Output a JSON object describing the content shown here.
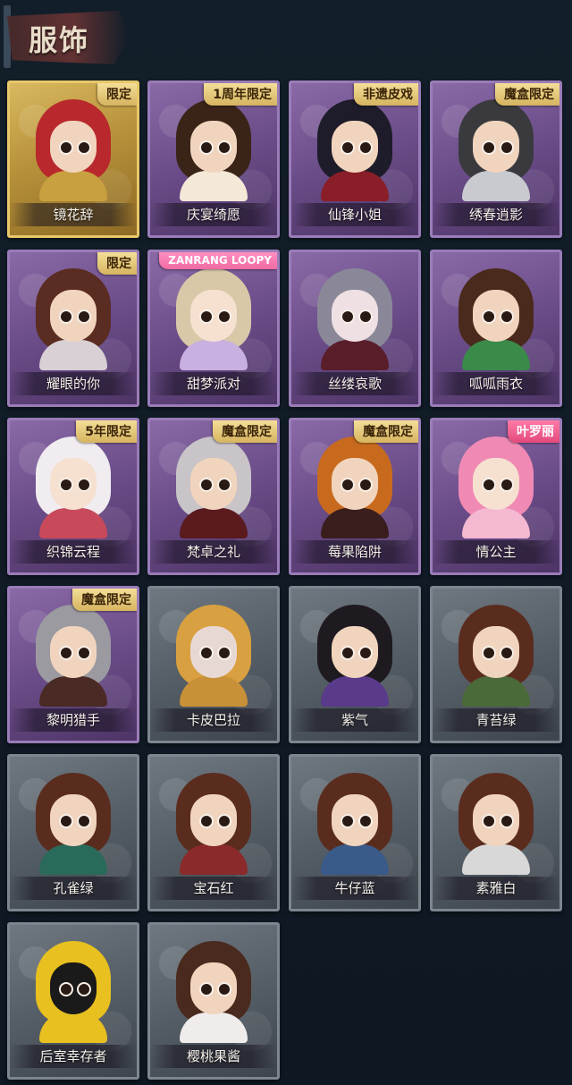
{
  "section_title": "服饰",
  "colors": {
    "background": "#0f1a24",
    "gold_card": "#d8b860",
    "purple_card": "#7a5c98",
    "gray_card": "#5a636b",
    "badge_gold": "#e6c878",
    "badge_pink": "#f06aa4"
  },
  "costumes": [
    {
      "name": "镜花辞",
      "badge": "限定",
      "frame": "gold",
      "hair": "#b8282c",
      "outfit": "#c8a040",
      "skin": "#f1d4bd"
    },
    {
      "name": "庆宴绮愿",
      "badge": "1周年限定",
      "frame": "purple",
      "hair": "#3a2418",
      "outfit": "#f4e8d8",
      "skin": "#f1d4bd"
    },
    {
      "name": "仙锋小姐",
      "badge": "非遗皮戏",
      "frame": "purple",
      "hair": "#1e1c2a",
      "outfit": "#8a1e28",
      "skin": "#f1d4bd"
    },
    {
      "name": "绣春逍影",
      "badge": "魔盒限定",
      "frame": "purple",
      "hair": "#3a3a3e",
      "outfit": "#c8cad0",
      "skin": "#f1d4bd"
    },
    {
      "name": "耀眼的你",
      "badge": "限定",
      "frame": "purple",
      "hair": "#5a2c22",
      "outfit": "#d8d0d4",
      "skin": "#f1d4bd"
    },
    {
      "name": "甜梦派对",
      "badge": "ZANRANG LOOPY",
      "frame": "purple",
      "hair": "#d8c8a8",
      "outfit": "#c8b0e0",
      "skin": "#f6e0d0"
    },
    {
      "name": "丝缕哀歌",
      "badge": "",
      "frame": "purple",
      "hair": "#8a8898",
      "outfit": "#5a1e2a",
      "skin": "#efe0e4"
    },
    {
      "name": "呱呱雨衣",
      "badge": "",
      "frame": "purple",
      "hair": "#4a2a1c",
      "outfit": "#3a8a4a",
      "skin": "#f1d4bd"
    },
    {
      "name": "织锦云程",
      "badge": "5年限定",
      "frame": "purple",
      "hair": "#f0ecf0",
      "outfit": "#c84a5a",
      "skin": "#f6e0d0"
    },
    {
      "name": "梵卓之礼",
      "badge": "魔盒限定",
      "frame": "purple",
      "hair": "#c8c4c8",
      "outfit": "#5a1a1e",
      "skin": "#f1d4bd"
    },
    {
      "name": "莓果陷阱",
      "badge": "魔盒限定",
      "frame": "purple",
      "hair": "#c86a1e",
      "outfit": "#3a1e1e",
      "skin": "#f1d4bd"
    },
    {
      "name": "情公主",
      "badge": "叶罗丽",
      "frame": "purple",
      "hair": "#f08ab4",
      "outfit": "#f4b8d0",
      "skin": "#f6e0d0"
    },
    {
      "name": "黎明猎手",
      "badge": "魔盒限定",
      "frame": "purple",
      "hair": "#9a9aa0",
      "outfit": "#4a2a24",
      "skin": "#f1d4bd"
    },
    {
      "name": "卡皮巴拉",
      "badge": "",
      "frame": "gray",
      "hair": "#d8a040",
      "outfit": "#c89038",
      "skin": "#e8d8d4"
    },
    {
      "name": "紫气",
      "badge": "",
      "frame": "gray",
      "hair": "#1e1a20",
      "outfit": "#5a3a8a",
      "skin": "#f1d4bd"
    },
    {
      "name": "青苔绿",
      "badge": "",
      "frame": "gray",
      "hair": "#5a2c1e",
      "outfit": "#4a6a3a",
      "skin": "#f1d4bd"
    },
    {
      "name": "孔雀绿",
      "badge": "",
      "frame": "gray",
      "hair": "#5a2c1e",
      "outfit": "#2a6a5a",
      "skin": "#f1d4bd"
    },
    {
      "name": "宝石红",
      "badge": "",
      "frame": "gray",
      "hair": "#5a2c1e",
      "outfit": "#8a2a2a",
      "skin": "#f1d4bd"
    },
    {
      "name": "牛仔蓝",
      "badge": "",
      "frame": "gray",
      "hair": "#5a2c1e",
      "outfit": "#3a5a8a",
      "skin": "#f1d4bd"
    },
    {
      "name": "素雅白",
      "badge": "",
      "frame": "gray",
      "hair": "#5a2c1e",
      "outfit": "#d8d8d8",
      "skin": "#f1d4bd"
    },
    {
      "name": "后室幸存者",
      "badge": "",
      "frame": "gray",
      "hair": "#e8c020",
      "outfit": "#e8c020",
      "skin": "#1a1a1a"
    },
    {
      "name": "樱桃果酱",
      "badge": "",
      "frame": "gray",
      "hair": "#4a2a1e",
      "outfit": "#f0ecec",
      "skin": "#f1d4bd"
    }
  ]
}
